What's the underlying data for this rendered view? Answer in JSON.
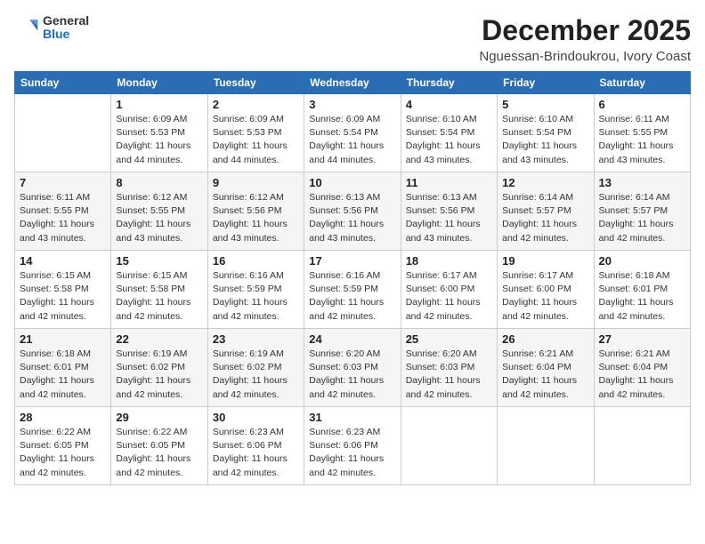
{
  "header": {
    "logo_general": "General",
    "logo_blue": "Blue",
    "title": "December 2025",
    "subtitle": "Nguessan-Brindoukrou, Ivory Coast"
  },
  "days_of_week": [
    "Sunday",
    "Monday",
    "Tuesday",
    "Wednesday",
    "Thursday",
    "Friday",
    "Saturday"
  ],
  "weeks": [
    [
      {
        "day": "",
        "info": ""
      },
      {
        "day": "1",
        "info": "Sunrise: 6:09 AM\nSunset: 5:53 PM\nDaylight: 11 hours and 44 minutes."
      },
      {
        "day": "2",
        "info": "Sunrise: 6:09 AM\nSunset: 5:53 PM\nDaylight: 11 hours and 44 minutes."
      },
      {
        "day": "3",
        "info": "Sunrise: 6:09 AM\nSunset: 5:54 PM\nDaylight: 11 hours and 44 minutes."
      },
      {
        "day": "4",
        "info": "Sunrise: 6:10 AM\nSunset: 5:54 PM\nDaylight: 11 hours and 43 minutes."
      },
      {
        "day": "5",
        "info": "Sunrise: 6:10 AM\nSunset: 5:54 PM\nDaylight: 11 hours and 43 minutes."
      },
      {
        "day": "6",
        "info": "Sunrise: 6:11 AM\nSunset: 5:55 PM\nDaylight: 11 hours and 43 minutes."
      }
    ],
    [
      {
        "day": "7",
        "info": "Sunrise: 6:11 AM\nSunset: 5:55 PM\nDaylight: 11 hours and 43 minutes."
      },
      {
        "day": "8",
        "info": "Sunrise: 6:12 AM\nSunset: 5:55 PM\nDaylight: 11 hours and 43 minutes."
      },
      {
        "day": "9",
        "info": "Sunrise: 6:12 AM\nSunset: 5:56 PM\nDaylight: 11 hours and 43 minutes."
      },
      {
        "day": "10",
        "info": "Sunrise: 6:13 AM\nSunset: 5:56 PM\nDaylight: 11 hours and 43 minutes."
      },
      {
        "day": "11",
        "info": "Sunrise: 6:13 AM\nSunset: 5:56 PM\nDaylight: 11 hours and 43 minutes."
      },
      {
        "day": "12",
        "info": "Sunrise: 6:14 AM\nSunset: 5:57 PM\nDaylight: 11 hours and 42 minutes."
      },
      {
        "day": "13",
        "info": "Sunrise: 6:14 AM\nSunset: 5:57 PM\nDaylight: 11 hours and 42 minutes."
      }
    ],
    [
      {
        "day": "14",
        "info": "Sunrise: 6:15 AM\nSunset: 5:58 PM\nDaylight: 11 hours and 42 minutes."
      },
      {
        "day": "15",
        "info": "Sunrise: 6:15 AM\nSunset: 5:58 PM\nDaylight: 11 hours and 42 minutes."
      },
      {
        "day": "16",
        "info": "Sunrise: 6:16 AM\nSunset: 5:59 PM\nDaylight: 11 hours and 42 minutes."
      },
      {
        "day": "17",
        "info": "Sunrise: 6:16 AM\nSunset: 5:59 PM\nDaylight: 11 hours and 42 minutes."
      },
      {
        "day": "18",
        "info": "Sunrise: 6:17 AM\nSunset: 6:00 PM\nDaylight: 11 hours and 42 minutes."
      },
      {
        "day": "19",
        "info": "Sunrise: 6:17 AM\nSunset: 6:00 PM\nDaylight: 11 hours and 42 minutes."
      },
      {
        "day": "20",
        "info": "Sunrise: 6:18 AM\nSunset: 6:01 PM\nDaylight: 11 hours and 42 minutes."
      }
    ],
    [
      {
        "day": "21",
        "info": "Sunrise: 6:18 AM\nSunset: 6:01 PM\nDaylight: 11 hours and 42 minutes."
      },
      {
        "day": "22",
        "info": "Sunrise: 6:19 AM\nSunset: 6:02 PM\nDaylight: 11 hours and 42 minutes."
      },
      {
        "day": "23",
        "info": "Sunrise: 6:19 AM\nSunset: 6:02 PM\nDaylight: 11 hours and 42 minutes."
      },
      {
        "day": "24",
        "info": "Sunrise: 6:20 AM\nSunset: 6:03 PM\nDaylight: 11 hours and 42 minutes."
      },
      {
        "day": "25",
        "info": "Sunrise: 6:20 AM\nSunset: 6:03 PM\nDaylight: 11 hours and 42 minutes."
      },
      {
        "day": "26",
        "info": "Sunrise: 6:21 AM\nSunset: 6:04 PM\nDaylight: 11 hours and 42 minutes."
      },
      {
        "day": "27",
        "info": "Sunrise: 6:21 AM\nSunset: 6:04 PM\nDaylight: 11 hours and 42 minutes."
      }
    ],
    [
      {
        "day": "28",
        "info": "Sunrise: 6:22 AM\nSunset: 6:05 PM\nDaylight: 11 hours and 42 minutes."
      },
      {
        "day": "29",
        "info": "Sunrise: 6:22 AM\nSunset: 6:05 PM\nDaylight: 11 hours and 42 minutes."
      },
      {
        "day": "30",
        "info": "Sunrise: 6:23 AM\nSunset: 6:06 PM\nDaylight: 11 hours and 42 minutes."
      },
      {
        "day": "31",
        "info": "Sunrise: 6:23 AM\nSunset: 6:06 PM\nDaylight: 11 hours and 42 minutes."
      },
      {
        "day": "",
        "info": ""
      },
      {
        "day": "",
        "info": ""
      },
      {
        "day": "",
        "info": ""
      }
    ]
  ]
}
